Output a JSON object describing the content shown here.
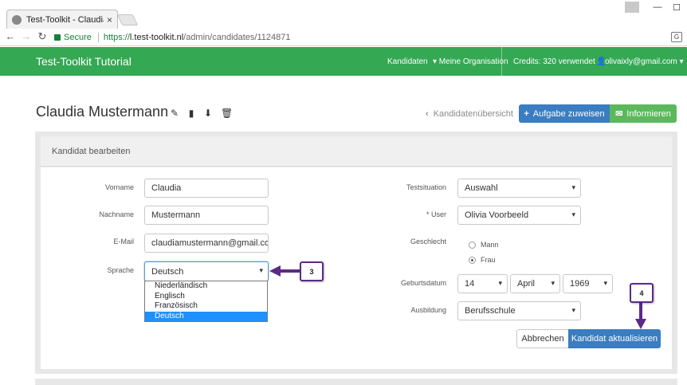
{
  "browser": {
    "tab_title": "Test-Toolkit - Claudia Mu",
    "tab_close": "×",
    "secure_label": "Secure",
    "url_proto": "https://",
    "url_host": "l.test-toolkit.nl",
    "url_path": "/admin/candidates/1124871",
    "min": "—",
    "max": "☐",
    "close": "✕"
  },
  "navbar": {
    "brand": "Test-Toolkit Tutorial",
    "items": [
      "Kandidaten",
      "▾ Meine Organisation",
      "Credits: 320 verwendet",
      "olivaixly@gmail.com ▾"
    ]
  },
  "header": {
    "title": "Claudia Mustermann",
    "back_link": "Kandidatenübersicht",
    "assign_button": "Aufgabe zuweisen",
    "inform_button": "Informieren"
  },
  "panel": {
    "title": "Kandidat bearbeiten"
  },
  "form": {
    "vorname_label": "Vorname",
    "vorname_value": "Claudia",
    "nachname_label": "Nachname",
    "nachname_value": "Mustermann",
    "email_label": "E-Mail",
    "email_value": "claudiamustermann@gmail.com",
    "sprache_label": "Sprache",
    "sprache_value": "Deutsch",
    "sprache_options": [
      "Niederländisch",
      "Englisch",
      "Französisch",
      "Deutsch"
    ],
    "testsituation_label": "Testsituation",
    "testsituation_value": "Auswahl",
    "user_label": "* User",
    "user_value": "Olivia Voorbeeld",
    "geschlecht_label": "Geschlecht",
    "gender_options": [
      "Mann",
      "Frau"
    ],
    "gender_selected": "Frau",
    "geburtsdatum_label": "Geburtsdatum",
    "birth_day": "14",
    "birth_month": "April",
    "birth_year": "1969",
    "ausbildung_label": "Ausbildung",
    "ausbildung_value": "Berufsschule",
    "cancel_button": "Abbrechen",
    "update_button": "Kandidat aktualisieren"
  },
  "annotations": {
    "callout_3": "3",
    "callout_4": "4",
    "arrow_color": "#5b2a86"
  }
}
